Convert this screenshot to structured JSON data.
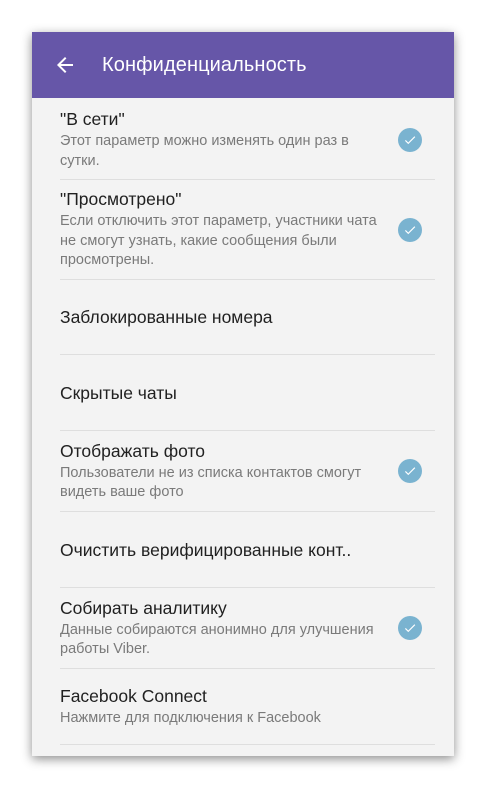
{
  "appbar": {
    "title": "Конфиденциальность",
    "back_icon": "arrow-left-icon"
  },
  "colors": {
    "appbar": "#6656a8",
    "background": "#f3f3f3",
    "check": "#7ab3d0"
  },
  "settings": [
    {
      "title": "\"В сети\"",
      "summary": "Этот параметр можно изменять один раз в сутки.",
      "checked": true
    },
    {
      "title": "\"Просмотрено\"",
      "summary": "Если отключить этот параметр, участники чата не смогут узнать, какие сообщения были просмотрены.",
      "checked": true
    },
    {
      "title": "Заблокированные номера",
      "summary": "",
      "checked": false
    },
    {
      "title": "Скрытые чаты",
      "summary": "",
      "checked": false
    },
    {
      "title": "Отображать фото",
      "summary": "Пользователи не из списка контактов смогут видеть ваше фото",
      "checked": true
    },
    {
      "title": "Очистить верифицированные конт..",
      "summary": "",
      "checked": false
    },
    {
      "title": "Собирать аналитику",
      "summary": "Данные собираются анонимно для улучшения работы Viber.",
      "checked": true
    },
    {
      "title": "Facebook Connect",
      "summary": "Нажмите для подключения к Facebook",
      "checked": false
    }
  ]
}
